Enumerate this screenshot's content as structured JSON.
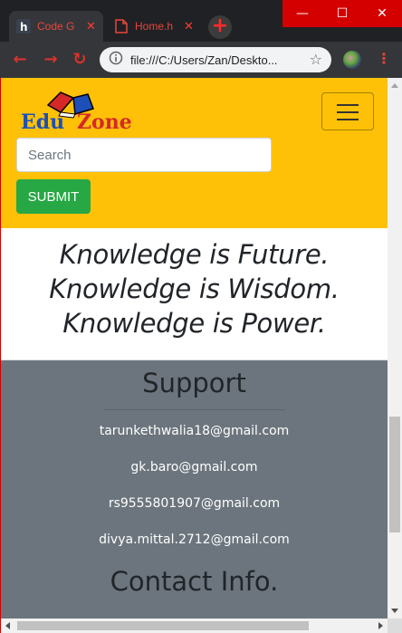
{
  "browser": {
    "tabs": [
      {
        "title": "Code G",
        "icon": "hackerrank-favicon-icon"
      },
      {
        "title": "Home.h",
        "icon": "document-icon"
      }
    ],
    "url": "file:///C:/Users/Zan/Deskto..."
  },
  "page": {
    "logo": {
      "word1": "Edu",
      "word2": "Zone"
    },
    "search": {
      "placeholder": "Search"
    },
    "submit_label": "SUBMIT",
    "hero": {
      "line1": "Knowledge is Future.",
      "line2": "Knowledge is Wisdom.",
      "line3": "Knowledge is Power."
    },
    "support": {
      "title": "Support",
      "emails": [
        "tarunkethwalia18@gmail.com",
        "gk.baro@gmail.com",
        "rs9555801907@gmail.com",
        "divya.mittal.2712@gmail.com"
      ],
      "contact_title": "Contact Info."
    }
  },
  "colors": {
    "header_bg": "#ffc107",
    "submit_bg": "#28a745",
    "support_bg": "#6c757d",
    "window_accent": "#d40000"
  }
}
